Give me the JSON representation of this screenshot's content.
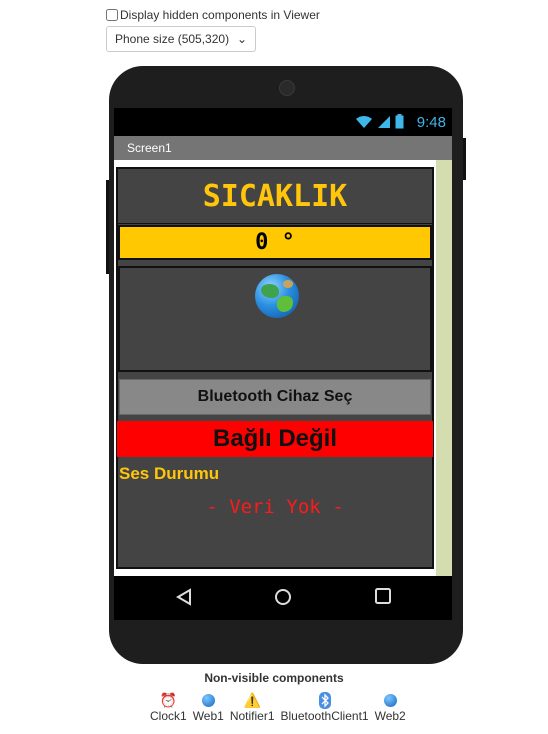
{
  "viewer": {
    "display_hidden_label": "Display hidden components in Viewer",
    "phone_size_selected": "Phone size (505,320)"
  },
  "status_bar": {
    "time": "9:48"
  },
  "screen": {
    "title": "Screen1",
    "sicaklik_label": "SICAKLIK",
    "temperature_value": "0 °",
    "bluetooth_button": "Bluetooth Cihaz Seç",
    "connection_status": "Bağlı Değil",
    "ses_label": "Ses Durumu",
    "veri_label": "- Veri Yok -"
  },
  "non_visible": {
    "title": "Non-visible components",
    "items": [
      {
        "label": "Clock1",
        "icon": "clock-icon"
      },
      {
        "label": "Web1",
        "icon": "web-icon"
      },
      {
        "label": "Notifier1",
        "icon": "warning-icon"
      },
      {
        "label": "BluetoothClient1",
        "icon": "bluetooth-icon"
      },
      {
        "label": "Web2",
        "icon": "web-icon"
      }
    ]
  },
  "colors": {
    "title_yellow": "#ffc60b",
    "temp_bg": "#ffc800",
    "status_red": "#ff0000",
    "screen_dark": "#444444"
  }
}
